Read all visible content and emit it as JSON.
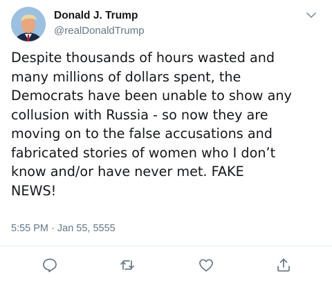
{
  "user": {
    "display_name": "Donald J. Trump",
    "username": "@realDonaldTrump"
  },
  "tweet": {
    "text": "Despite thousands of hours wasted and\nmany millions of dollars spent, the\nDemocrats have been unable to show any\ncollusion with Russia - so now they are\nmoving on to the false accusations and\nfabricated stories of women who I don’t\nknow and/or have never met. FAKE\nNEWS!",
    "timestamp": "5:55 PM · Jan 55, 5555"
  },
  "icons": {
    "avatar": "profile-photo",
    "menu": "chevron-down-icon",
    "reply": "reply-icon",
    "retweet": "retweet-icon",
    "like": "heart-icon",
    "share": "share-icon"
  },
  "colors": {
    "text_primary": "#14171a",
    "text_secondary": "#657786",
    "icon": "#657786",
    "divider": "#e1e8ed"
  }
}
